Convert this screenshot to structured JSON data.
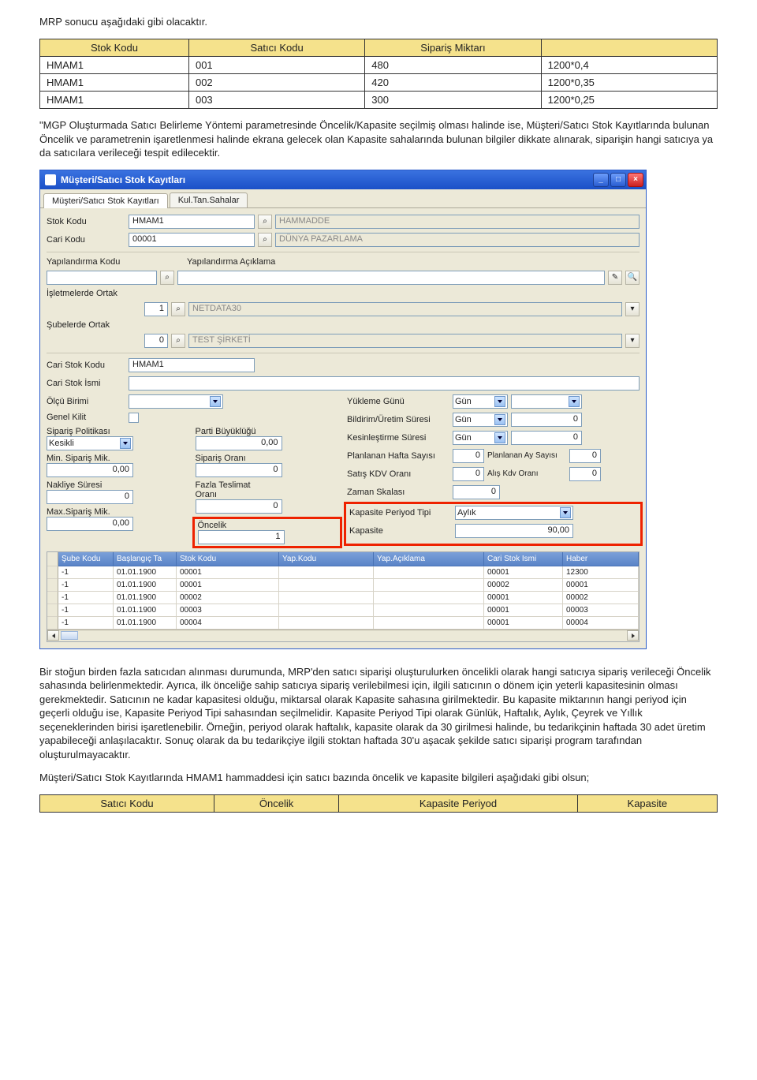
{
  "doc": {
    "title_line": "MRP sonucu aşağıdaki gibi olacaktır.",
    "after_table": "\"MGP Oluşturmada Satıcı Belirleme Yöntemi parametresinde Öncelik/Kapasite seçilmiş olması halinde ise, Müşteri/Satıcı Stok Kayıtlarında bulunan Öncelik ve parametrenin işaretlenmesi halinde ekrana gelecek olan Kapasite sahalarında bulunan bilgiler dikkate alınarak, siparişin hangi satıcıya ya da satıcılara verileceği tespit edilecektir.",
    "after_window": "Bir stoğun birden fazla satıcıdan alınması durumunda, MRP'den satıcı siparişi oluşturulurken öncelikli olarak hangi satıcıya sipariş verileceği Öncelik sahasında belirlenmektedir. Ayrıca, ilk önceliğe sahip satıcıya sipariş verilebilmesi için, ilgili satıcının o dönem için yeterli kapasitesinin olması gerekmektedir. Satıcının ne kadar kapasitesi olduğu, miktarsal olarak Kapasite sahasına girilmektedir. Bu kapasite miktarının hangi periyod için geçerli olduğu ise, Kapasite Periyod Tipi sahasından seçilmelidir. Kapasite Periyod Tipi olarak Günlük, Haftalık, Aylık, Çeyrek ve Yıllık seçeneklerinden birisi işaretlenebilir. Örneğin, periyod olarak haftalık, kapasite olarak da 30 girilmesi halinde, bu tedarikçinin haftada 30 adet üretim yapabileceği anlaşılacaktır. Sonuç olarak da bu tedarikçiye ilgili stoktan haftada 30'u aşacak şekilde satıcı siparişi program tarafından oluşturulmayacaktır.",
    "footer_para": "Müşteri/Satıcı Stok Kayıtlarında HMAM1 hammaddesi için satıcı bazında öncelik ve kapasite bilgileri aşağıdaki gibi olsun;"
  },
  "param_table": {
    "headers": [
      "Stok Kodu",
      "Satıcı Kodu",
      "Sipariş Miktarı",
      ""
    ],
    "rows": [
      [
        "HMAM1",
        "001",
        "480",
        "1200*0,4"
      ],
      [
        "HMAM1",
        "002",
        "420",
        "1200*0,35"
      ],
      [
        "HMAM1",
        "003",
        "300",
        "1200*0,25"
      ]
    ]
  },
  "window": {
    "title": "Müşteri/Satıcı Stok Kayıtları",
    "tabs": [
      "Müşteri/Satıcı Stok Kayıtları",
      "Kul.Tan.Sahalar"
    ],
    "labels": {
      "stok_kodu": "Stok Kodu",
      "cari_kodu": "Cari Kodu",
      "yap_kodu": "Yapılandırma Kodu",
      "yap_acik": "Yapılandırma Açıklama",
      "isl_ortak": "İşletmelerde Ortak",
      "sub_ortak": "Şubelerde Ortak",
      "cari_stok_kodu": "Cari Stok Kodu",
      "cari_stok_ismi": "Cari Stok İsmi",
      "olcu": "Ölçü Birimi",
      "genel_kilit": "Genel Kilit",
      "sip_pol": "Sipariş Politikası",
      "min_sip": "Min. Sipariş Mik.",
      "nakliye": "Nakliye Süresi",
      "max_sip": "Max.Sipariş Mik.",
      "parti": "Parti Büyüklüğü",
      "sip_orani": "Sipariş Oranı",
      "fazla_teslimat": "Fazla Teslimat Oranı",
      "oncelik": "Öncelik",
      "yukleme": "Yükleme Günü",
      "bildirim": "Bildirim/Üretim Süresi",
      "kesin": "Kesinleştirme Süresi",
      "plan_hafta": "Planlanan Hafta Sayısı",
      "satis_kdv": "Satış KDV Oranı",
      "zaman_skala": "Zaman Skalası",
      "kapasite_periyod": "Kapasite Periyod Tipi",
      "kapasite": "Kapasite",
      "gun": "Gün",
      "plan_ay": "Planlanan Ay Sayısı",
      "alis_kdv": "Alış Kdv Oranı",
      "aylik": "Aylık"
    },
    "values": {
      "stok_kodu": "HMAM1",
      "stok_ad": "HAMMADDE",
      "cari_kodu": "00001",
      "cari_ad": "DÜNYA PAZARLAMA",
      "isl_ortak_val": "1",
      "isl_ortak_name": "NETDATA30",
      "sub_ortak_val": "0",
      "sub_ortak_name": "TEST ŞİRKETİ",
      "cari_stok_kodu": "HMAM1",
      "sip_pol": "Kesikli",
      "min_sip": "0,00",
      "nakliye": "0",
      "max_sip": "0,00",
      "parti": "0,00",
      "sip_orani": "0",
      "fazla_teslimat": "0",
      "oncelik": "1",
      "bildirim_val": "0",
      "kesin_val": "0",
      "plan_hafta_val": "0",
      "satis_kdv_val": "0",
      "zaman_skala_val": "0",
      "kapasite_val": "90,00",
      "plan_ay_val": "0",
      "alis_kdv_val": "0"
    },
    "grid": {
      "headers": [
        "Şube Kodu",
        "Başlangıç Ta",
        "Stok Kodu",
        "Yap.Kodu",
        "Yap.Açıklama",
        "Cari Stok Ismi",
        "Haber"
      ],
      "rows": [
        [
          "-1",
          "01.01.1900",
          "00001",
          "",
          "",
          "00001",
          "12300"
        ],
        [
          "-1",
          "01.01.1900",
          "00001",
          "",
          "",
          "00002",
          "00001"
        ],
        [
          "-1",
          "01.01.1900",
          "00002",
          "",
          "",
          "00001",
          "00002"
        ],
        [
          "-1",
          "01.01.1900",
          "00003",
          "",
          "",
          "00001",
          "00003"
        ],
        [
          "-1",
          "01.01.1900",
          "00004",
          "",
          "",
          "00001",
          "00004"
        ]
      ]
    }
  },
  "bottom_table": {
    "headers": [
      "Satıcı Kodu",
      "Öncelik",
      "Kapasite Periyod",
      "Kapasite"
    ]
  }
}
